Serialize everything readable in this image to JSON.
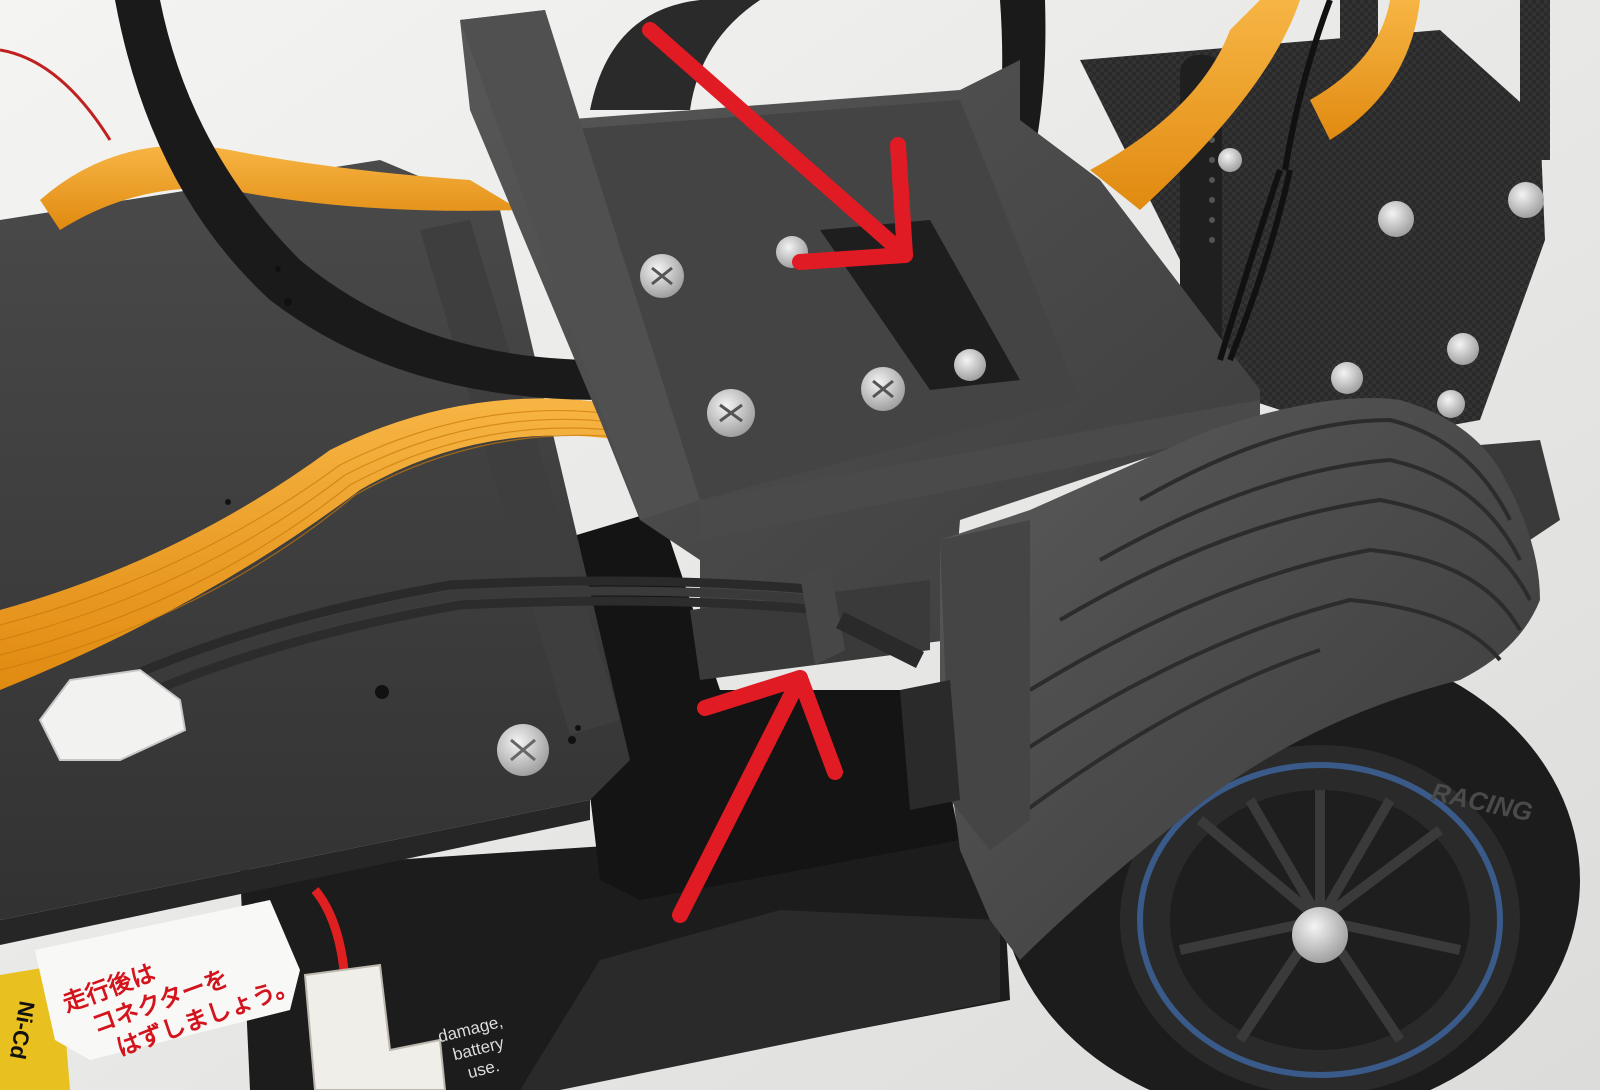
{
  "photo": {
    "warning_label": {
      "lines": [
        "走行後は",
        "コネクターを",
        "はずしましょう。"
      ],
      "color": "#d4141c"
    },
    "battery_label": {
      "lines": [
        "damage,",
        "battery",
        "use."
      ]
    },
    "side_label": {
      "text": "Ni-Cd"
    },
    "tire_brand": {
      "text": "RACING"
    },
    "colors": {
      "background": "#ececea",
      "chassis_dark": "#3a3a3a",
      "flex_cable": "#f0a020",
      "arrow": "#e01b24",
      "red_wire": "#e02020"
    }
  }
}
